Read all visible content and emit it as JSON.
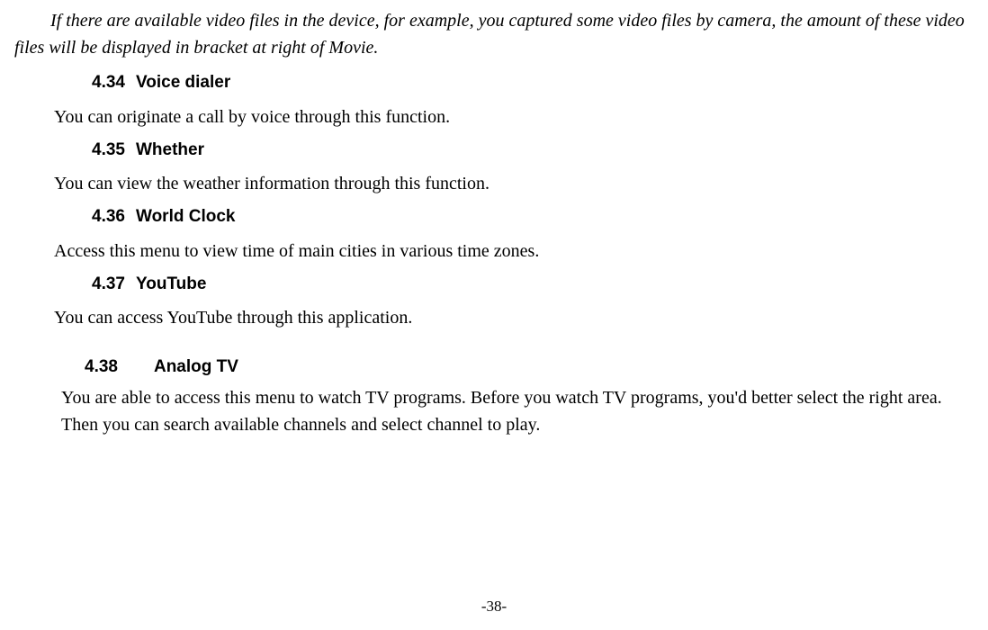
{
  "intro": "If there are available video files in the device, for example, you captured some video files by camera, the amount of these video files will be displayed in bracket at right of Movie.",
  "sections": {
    "s434": {
      "num": "4.34",
      "title": "Voice dialer",
      "body": "You can originate a call by voice through this function."
    },
    "s435": {
      "num": "4.35",
      "title": "Whether",
      "body": "You can view the weather information through this function."
    },
    "s436": {
      "num": "4.36",
      "title": "World Clock",
      "body": "Access this menu to view time of main cities in various time zones."
    },
    "s437": {
      "num": "4.37",
      "title": "YouTube",
      "body": "You can access YouTube through this application."
    },
    "s438": {
      "num": "4.38",
      "title": "Analog TV",
      "body": "You are able to access this menu to watch TV programs. Before you watch TV programs, you'd better select the right area. Then you can search available channels and select channel to play."
    }
  },
  "pageNumber": "-38-"
}
